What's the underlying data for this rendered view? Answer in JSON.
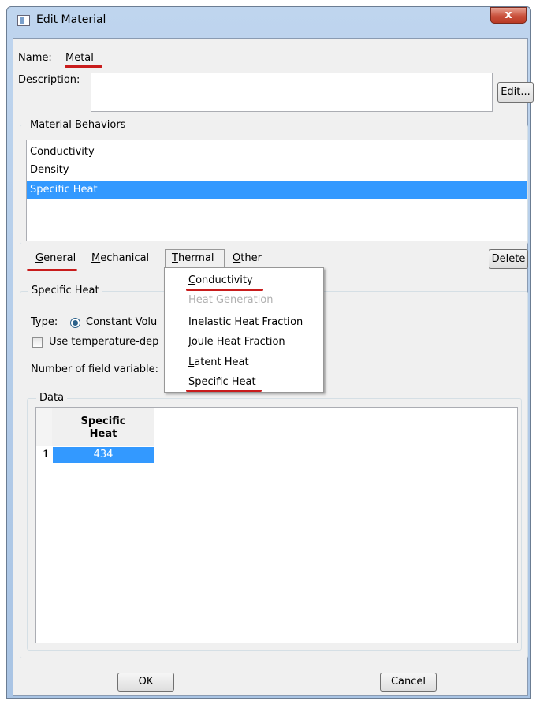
{
  "window": {
    "title": "Edit Material",
    "close_glyph": "x"
  },
  "name": {
    "label": "Name:",
    "value": "Metal"
  },
  "description": {
    "label": "Description:",
    "value": "",
    "edit_button": "Edit..."
  },
  "behaviors": {
    "group_title": "Material Behaviors",
    "items": [
      {
        "label": "Conductivity",
        "selected": false
      },
      {
        "label": "Density",
        "selected": false
      },
      {
        "label": "Specific Heat",
        "selected": true
      }
    ]
  },
  "menubar": {
    "items": [
      {
        "label": "General",
        "mnemonic": "G"
      },
      {
        "label": "Mechanical",
        "mnemonic": "M"
      },
      {
        "label": "Thermal",
        "mnemonic": "T"
      },
      {
        "label": "Other",
        "mnemonic": "O"
      }
    ],
    "delete_button": "Delete"
  },
  "thermal_menu": {
    "items": [
      {
        "label": "Conductivity",
        "enabled": true
      },
      {
        "label": "Heat Generation",
        "enabled": false
      },
      {
        "label": "Inelastic Heat Fraction",
        "enabled": true
      },
      {
        "label": "Joule Heat Fraction",
        "enabled": true
      },
      {
        "label": "Latent Heat",
        "enabled": true
      },
      {
        "label": "Specific Heat",
        "enabled": true
      }
    ]
  },
  "specific_heat": {
    "group_title": "Specific Heat",
    "type_label": "Type:",
    "type_value": "Constant Volu",
    "temp_dep_label": "Use temperature-dep",
    "field_vars_label": "Number of field variable:",
    "data_title": "Data",
    "table": {
      "column_header_line1": "Specific",
      "column_header_line2": "Heat",
      "rows": [
        {
          "index": "1",
          "value": "434"
        }
      ]
    }
  },
  "footer": {
    "ok": "OK",
    "cancel": "Cancel"
  },
  "colors": {
    "selection": "#3399ff",
    "annotation": "#c81c1c",
    "close": "#c9503c"
  }
}
